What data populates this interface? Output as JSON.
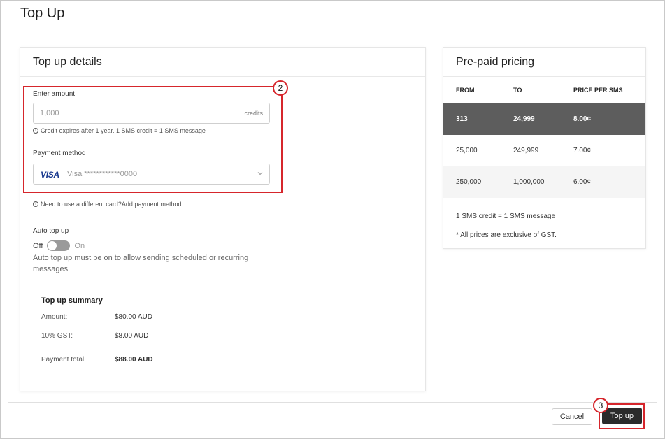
{
  "page": {
    "title": "Top Up"
  },
  "details": {
    "header": "Top up details",
    "amount": {
      "label": "Enter amount",
      "value": "1,000",
      "unit": "credits"
    },
    "amount_hint": "Credit expires after 1 year. 1 SMS credit = 1 SMS message",
    "payment": {
      "label": "Payment method",
      "brand": "VISA",
      "card_text": "Visa ************0000"
    },
    "card_hint": "Need to use a different card?",
    "add_payment_link": "Add payment method",
    "auto_top_up": {
      "label": "Auto top up",
      "off": "Off",
      "on": "On",
      "state": "off",
      "description": "Auto top up must be on to allow sending scheduled or recurring messages"
    },
    "summary": {
      "title": "Top up summary",
      "rows": [
        {
          "label": "Amount:",
          "value": "$80.00 AUD"
        },
        {
          "label": "10% GST:",
          "value": "$8.00 AUD"
        }
      ],
      "total": {
        "label": "Payment total:",
        "value": "$88.00 AUD"
      }
    }
  },
  "pricing": {
    "header": "Pre-paid pricing",
    "columns": [
      "FROM",
      "TO",
      "PRICE PER SMS"
    ],
    "rows": [
      [
        "313",
        "24,999",
        "8.00¢"
      ],
      [
        "25,000",
        "249,999",
        "7.00¢"
      ],
      [
        "250,000",
        "1,000,000",
        "6.00¢"
      ]
    ],
    "highlighted_row": 0,
    "note1": "1 SMS credit = 1 SMS message",
    "note2": "* All prices are exclusive of GST."
  },
  "annotations": {
    "badge_2": "2",
    "badge_3": "3"
  },
  "actions": {
    "cancel": "Cancel",
    "top_up": "Top up"
  },
  "colors": {
    "annotation_red": "#d6262c",
    "primary_button": "#2b2b2b",
    "highlight_row": "#5d5d5d"
  }
}
